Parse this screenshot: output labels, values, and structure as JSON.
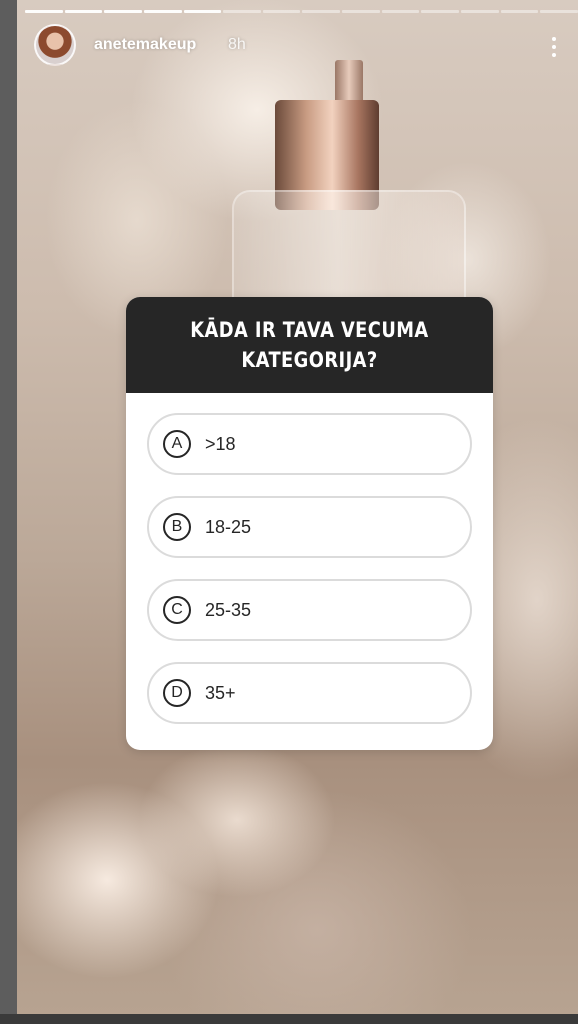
{
  "story": {
    "progress_segments": 14,
    "progress_completed": 5,
    "username": "anetemakeup",
    "timestamp": "8h",
    "more_icon": "more-vertical-icon"
  },
  "quiz": {
    "question": "KĀDA IR TAVA VECUMA KATEGORIJA?",
    "header_color": "#262626",
    "options": [
      {
        "letter": "A",
        "text": ">18"
      },
      {
        "letter": "B",
        "text": "18-25"
      },
      {
        "letter": "C",
        "text": "25-35"
      },
      {
        "letter": "D",
        "text": "35+"
      }
    ]
  }
}
